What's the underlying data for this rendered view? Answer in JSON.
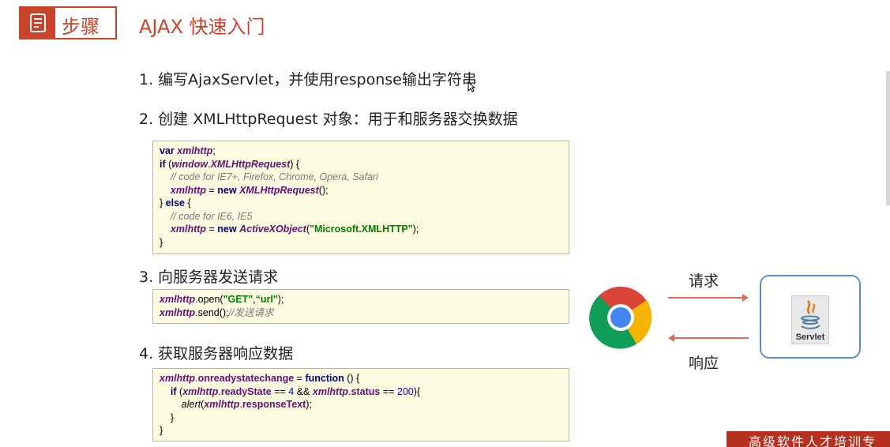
{
  "header": {
    "badge_label": "步骤",
    "title": "AJAX 快速入门",
    "accent_color": "#c9442a",
    "badge_icon": "document-icon"
  },
  "steps": [
    {
      "label": "1. 编写AjaxServlet，并使用response输出字符串"
    },
    {
      "label": "2. 创建 XMLHttpRequest 对象：用于和服务器交换数据"
    },
    {
      "label": "3. 向服务器发送请求"
    },
    {
      "label": "4. 获取服务器响应数据"
    }
  ],
  "code_blocks": {
    "create": [
      "var xmlhttp;",
      "if (window.XMLHttpRequest) {",
      "// code for IE7+, Firefox, Chrome, Opera, Safari",
      "xmlhttp = new XMLHttpRequest();",
      "} else {",
      "// code for IE6, IE5",
      "xmlhttp = new ActiveXObject(\"Microsoft.XMLHTTP\");",
      "}"
    ],
    "send": [
      "xmlhttp.open(\"GET\",“url\");",
      "xmlhttp.send();//发送请求"
    ],
    "receive": [
      "xmlhttp.onreadystatechange = function () {",
      "if (xmlhttp.readyState == 4 && xmlhttp.status == 200){",
      "alert(xmlhttp.responseText);",
      "}",
      "}"
    ]
  },
  "diagram": {
    "request_label": "请求",
    "response_label": "响应",
    "client_icon": "chrome-icon",
    "server_icon": "java-icon",
    "server_label": "Servlet",
    "arrow_color": "#d9705a",
    "server_border_color": "#5b8dc9"
  },
  "footer": {
    "banner_text": "高级软件人才培训专",
    "banner_color": "#b5301f"
  }
}
